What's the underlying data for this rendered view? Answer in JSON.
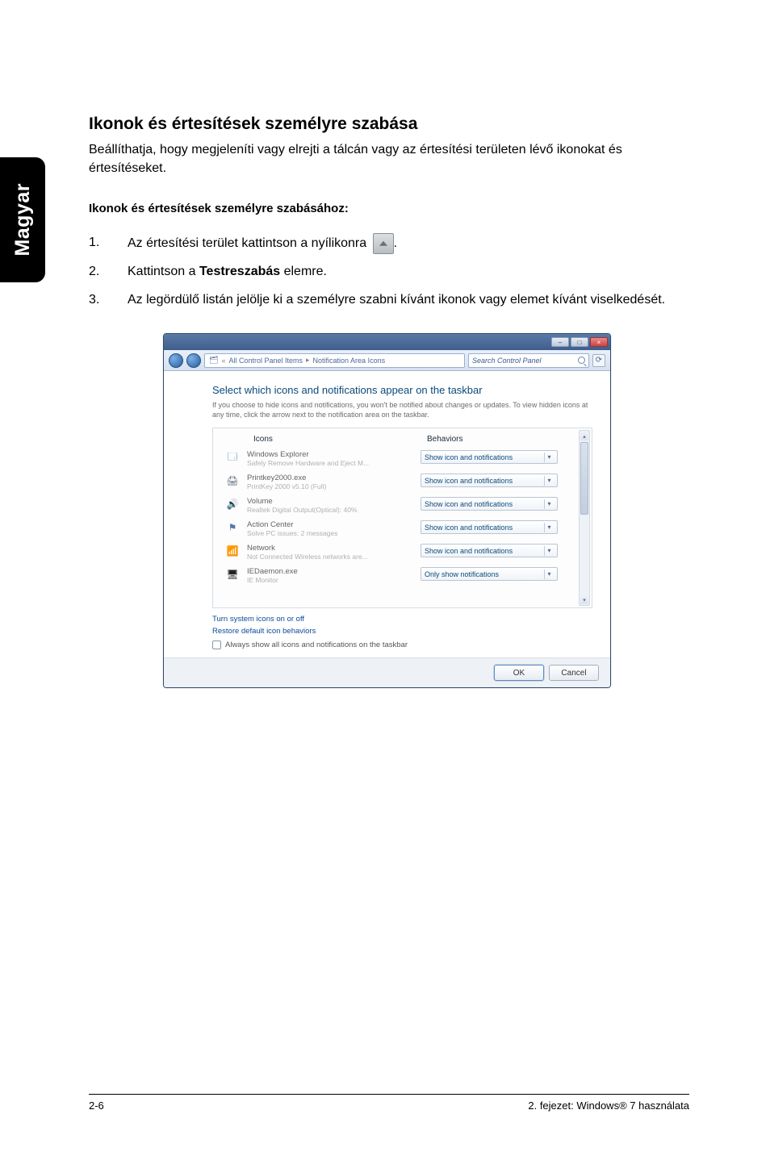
{
  "sidebar": {
    "lang": "Magyar"
  },
  "doc": {
    "title": "Ikonok és értesítések személyre szabása",
    "intro": "Beállíthatja, hogy megjeleníti vagy elrejti a tálcán vagy az értesítési területen lévő ikonokat és értesítéseket.",
    "subtitle": "Ikonok és értesítések személyre szabásához:",
    "steps": {
      "s1": {
        "num": "1.",
        "text": "Az értesítési terület kattintson a nyílikonra",
        "after_icon": "."
      },
      "s2": {
        "num": "2.",
        "pre": "Kattintson a ",
        "bold": "Testreszabás",
        "post": " elemre."
      },
      "s3": {
        "num": "3.",
        "text": "Az legördülő listán jelölje ki a személyre szabni kívánt ikonok vagy elemet kívánt viselkedését."
      }
    }
  },
  "window": {
    "breadcrumb": {
      "seg1": "All Control Panel Items",
      "seg2": "Notification Area Icons"
    },
    "search_placeholder": "Search Control Panel",
    "heading": "Select which icons and notifications appear on the taskbar",
    "description": "If you choose to hide icons and notifications, you won't be notified about changes or updates. To view hidden icons at any time, click the arrow next to the notification area on the taskbar.",
    "columns": {
      "c1": "Icons",
      "c2": "Behaviors"
    },
    "rows": [
      {
        "title": "Windows Explorer",
        "sub": "Safely Remove Hardware and Eject M...",
        "behavior": "Show icon and notifications"
      },
      {
        "title": "Printkey2000.exe",
        "sub": "PrintKey 2000 v5.10 (Full)",
        "behavior": "Show icon and notifications"
      },
      {
        "title": "Volume",
        "sub": "Realtek Digital Output(Optical): 40%",
        "behavior": "Show icon and notifications"
      },
      {
        "title": "Action Center",
        "sub": "Solve PC issues: 2 messages",
        "behavior": "Show icon and notifications"
      },
      {
        "title": "Network",
        "sub": "Not Connected Wireless networks are...",
        "behavior": "Show icon and notifications"
      },
      {
        "title": "IEDaemon.exe",
        "sub": "IE Monitor",
        "behavior": "Only show notifications"
      }
    ],
    "links": {
      "l1": "Turn system icons on or off",
      "l2": "Restore default icon behaviors"
    },
    "checkbox_label": "Always show all icons and notifications on the taskbar",
    "buttons": {
      "ok": "OK",
      "cancel": "Cancel"
    }
  },
  "footer": {
    "left": "2-6",
    "right": "2. fejezet: Windows® 7 használata"
  }
}
